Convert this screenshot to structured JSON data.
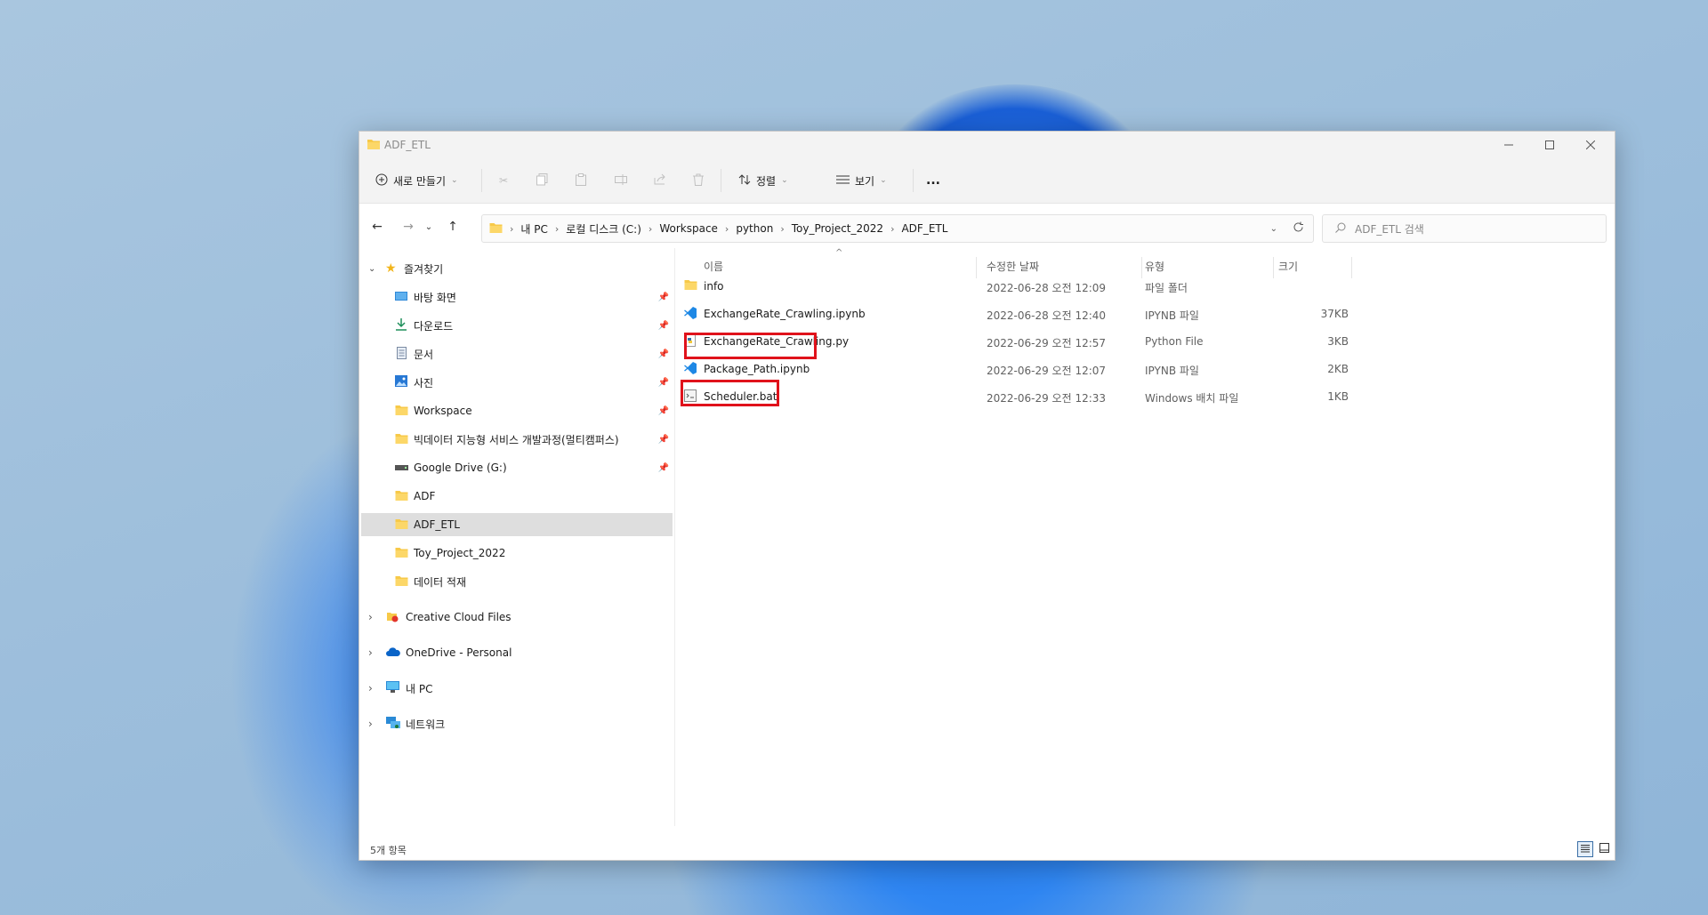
{
  "window": {
    "title": "ADF_ETL"
  },
  "toolbar": {
    "new_label": "새로 만들기",
    "sort_label": "정렬",
    "view_label": "보기",
    "more_label": "..."
  },
  "address": {
    "crumbs": [
      "내 PC",
      "로컬 디스크 (C:)",
      "Workspace",
      "python",
      "Toy_Project_2022",
      "ADF_ETL"
    ]
  },
  "search": {
    "placeholder": "ADF_ETL 검색"
  },
  "sidebar": {
    "quick_access": "즐겨찾기",
    "items": [
      {
        "label": "바탕 화면",
        "icon": "desktop-icon",
        "pinned": true
      },
      {
        "label": "다운로드",
        "icon": "download-icon",
        "pinned": true
      },
      {
        "label": "문서",
        "icon": "document-icon",
        "pinned": true
      },
      {
        "label": "사진",
        "icon": "picture-icon",
        "pinned": true
      },
      {
        "label": "Workspace",
        "icon": "folder-icon",
        "pinned": true
      },
      {
        "label": "빅데이터 지능형 서비스 개발과정(멀티캠퍼스)",
        "icon": "folder-icon",
        "pinned": true
      },
      {
        "label": "Google Drive (G:)",
        "icon": "drive-icon",
        "pinned": true
      },
      {
        "label": "ADF",
        "icon": "folder-icon",
        "pinned": false
      },
      {
        "label": "ADF_ETL",
        "icon": "folder-icon",
        "pinned": false,
        "selected": true
      },
      {
        "label": "Toy_Project_2022",
        "icon": "folder-icon",
        "pinned": false
      },
      {
        "label": "데이터 적재",
        "icon": "folder-icon",
        "pinned": false
      }
    ],
    "roots": [
      {
        "label": "Creative Cloud Files",
        "icon": "creative-cloud-icon"
      },
      {
        "label": "OneDrive - Personal",
        "icon": "onedrive-icon"
      },
      {
        "label": "내 PC",
        "icon": "pc-icon"
      },
      {
        "label": "네트워크",
        "icon": "network-icon"
      }
    ]
  },
  "columns": {
    "name": "이름",
    "date": "수정한 날짜",
    "type": "유형",
    "size": "크기"
  },
  "files": [
    {
      "name": "info",
      "date": "2022-06-28 오전 12:09",
      "type": "파일 폴더",
      "size": "",
      "icon": "folder-icon"
    },
    {
      "name": "ExchangeRate_Crawling.ipynb",
      "date": "2022-06-28 오전 12:40",
      "type": "IPYNB 파일",
      "size": "37KB",
      "icon": "vscode-icon"
    },
    {
      "name": "ExchangeRate_Crawling.py",
      "date": "2022-06-29 오전 12:57",
      "type": "Python File",
      "size": "3KB",
      "icon": "python-icon"
    },
    {
      "name": "Package_Path.ipynb",
      "date": "2022-06-29 오전 12:07",
      "type": "IPYNB 파일",
      "size": "2KB",
      "icon": "vscode-icon"
    },
    {
      "name": "Scheduler.bat",
      "date": "2022-06-29 오전 12:33",
      "type": "Windows 배치 파일",
      "size": "1KB",
      "icon": "batch-file-icon"
    }
  ],
  "status": {
    "count": "5개 항목"
  },
  "colors": {
    "accent": "#0067c0",
    "highlight": "#e0121b",
    "folder": "#f7c948"
  }
}
